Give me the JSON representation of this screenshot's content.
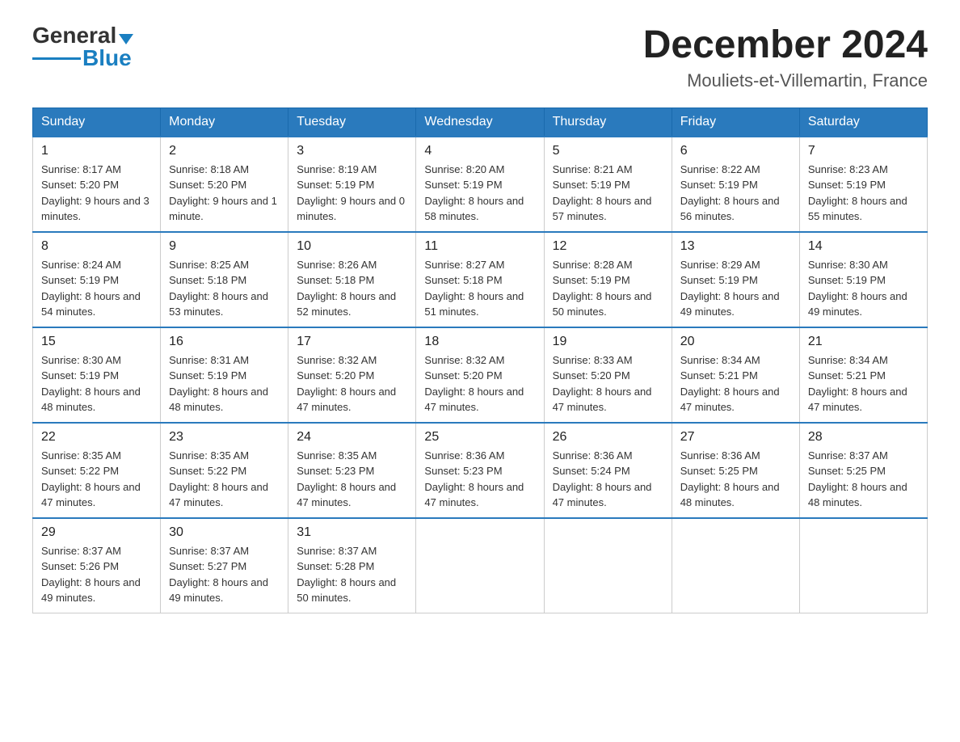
{
  "header": {
    "logo_general": "General",
    "logo_blue": "Blue",
    "month_title": "December 2024",
    "location": "Mouliets-et-Villemartin, France"
  },
  "days_of_week": [
    "Sunday",
    "Monday",
    "Tuesday",
    "Wednesday",
    "Thursday",
    "Friday",
    "Saturday"
  ],
  "weeks": [
    [
      {
        "day": "1",
        "sunrise": "8:17 AM",
        "sunset": "5:20 PM",
        "daylight": "9 hours and 3 minutes."
      },
      {
        "day": "2",
        "sunrise": "8:18 AM",
        "sunset": "5:20 PM",
        "daylight": "9 hours and 1 minute."
      },
      {
        "day": "3",
        "sunrise": "8:19 AM",
        "sunset": "5:19 PM",
        "daylight": "9 hours and 0 minutes."
      },
      {
        "day": "4",
        "sunrise": "8:20 AM",
        "sunset": "5:19 PM",
        "daylight": "8 hours and 58 minutes."
      },
      {
        "day": "5",
        "sunrise": "8:21 AM",
        "sunset": "5:19 PM",
        "daylight": "8 hours and 57 minutes."
      },
      {
        "day": "6",
        "sunrise": "8:22 AM",
        "sunset": "5:19 PM",
        "daylight": "8 hours and 56 minutes."
      },
      {
        "day": "7",
        "sunrise": "8:23 AM",
        "sunset": "5:19 PM",
        "daylight": "8 hours and 55 minutes."
      }
    ],
    [
      {
        "day": "8",
        "sunrise": "8:24 AM",
        "sunset": "5:19 PM",
        "daylight": "8 hours and 54 minutes."
      },
      {
        "day": "9",
        "sunrise": "8:25 AM",
        "sunset": "5:18 PM",
        "daylight": "8 hours and 53 minutes."
      },
      {
        "day": "10",
        "sunrise": "8:26 AM",
        "sunset": "5:18 PM",
        "daylight": "8 hours and 52 minutes."
      },
      {
        "day": "11",
        "sunrise": "8:27 AM",
        "sunset": "5:18 PM",
        "daylight": "8 hours and 51 minutes."
      },
      {
        "day": "12",
        "sunrise": "8:28 AM",
        "sunset": "5:19 PM",
        "daylight": "8 hours and 50 minutes."
      },
      {
        "day": "13",
        "sunrise": "8:29 AM",
        "sunset": "5:19 PM",
        "daylight": "8 hours and 49 minutes."
      },
      {
        "day": "14",
        "sunrise": "8:30 AM",
        "sunset": "5:19 PM",
        "daylight": "8 hours and 49 minutes."
      }
    ],
    [
      {
        "day": "15",
        "sunrise": "8:30 AM",
        "sunset": "5:19 PM",
        "daylight": "8 hours and 48 minutes."
      },
      {
        "day": "16",
        "sunrise": "8:31 AM",
        "sunset": "5:19 PM",
        "daylight": "8 hours and 48 minutes."
      },
      {
        "day": "17",
        "sunrise": "8:32 AM",
        "sunset": "5:20 PM",
        "daylight": "8 hours and 47 minutes."
      },
      {
        "day": "18",
        "sunrise": "8:32 AM",
        "sunset": "5:20 PM",
        "daylight": "8 hours and 47 minutes."
      },
      {
        "day": "19",
        "sunrise": "8:33 AM",
        "sunset": "5:20 PM",
        "daylight": "8 hours and 47 minutes."
      },
      {
        "day": "20",
        "sunrise": "8:34 AM",
        "sunset": "5:21 PM",
        "daylight": "8 hours and 47 minutes."
      },
      {
        "day": "21",
        "sunrise": "8:34 AM",
        "sunset": "5:21 PM",
        "daylight": "8 hours and 47 minutes."
      }
    ],
    [
      {
        "day": "22",
        "sunrise": "8:35 AM",
        "sunset": "5:22 PM",
        "daylight": "8 hours and 47 minutes."
      },
      {
        "day": "23",
        "sunrise": "8:35 AM",
        "sunset": "5:22 PM",
        "daylight": "8 hours and 47 minutes."
      },
      {
        "day": "24",
        "sunrise": "8:35 AM",
        "sunset": "5:23 PM",
        "daylight": "8 hours and 47 minutes."
      },
      {
        "day": "25",
        "sunrise": "8:36 AM",
        "sunset": "5:23 PM",
        "daylight": "8 hours and 47 minutes."
      },
      {
        "day": "26",
        "sunrise": "8:36 AM",
        "sunset": "5:24 PM",
        "daylight": "8 hours and 47 minutes."
      },
      {
        "day": "27",
        "sunrise": "8:36 AM",
        "sunset": "5:25 PM",
        "daylight": "8 hours and 48 minutes."
      },
      {
        "day": "28",
        "sunrise": "8:37 AM",
        "sunset": "5:25 PM",
        "daylight": "8 hours and 48 minutes."
      }
    ],
    [
      {
        "day": "29",
        "sunrise": "8:37 AM",
        "sunset": "5:26 PM",
        "daylight": "8 hours and 49 minutes."
      },
      {
        "day": "30",
        "sunrise": "8:37 AM",
        "sunset": "5:27 PM",
        "daylight": "8 hours and 49 minutes."
      },
      {
        "day": "31",
        "sunrise": "8:37 AM",
        "sunset": "5:28 PM",
        "daylight": "8 hours and 50 minutes."
      },
      null,
      null,
      null,
      null
    ]
  ]
}
